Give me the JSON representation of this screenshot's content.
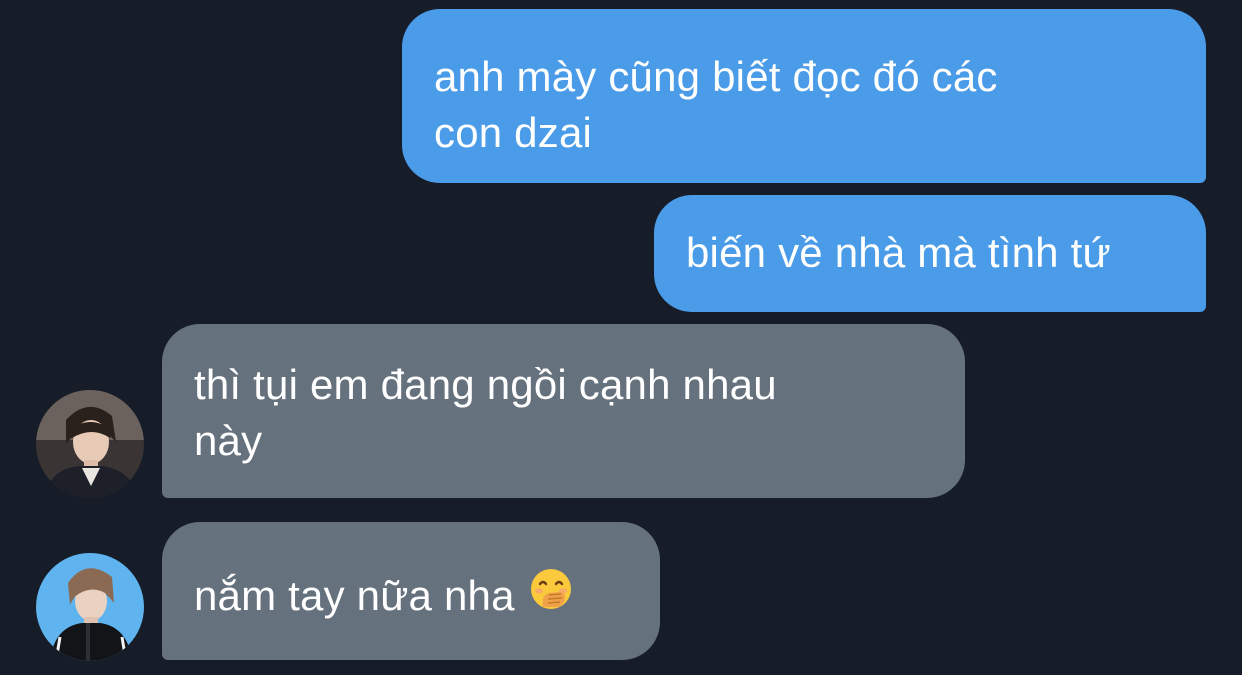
{
  "conversation": {
    "messages": [
      {
        "direction": "sent",
        "lines": [
          "anh mày cũng biết đọc đó các",
          "con dzai"
        ]
      },
      {
        "direction": "sent",
        "lines": [
          "biến về nhà mà tình tứ"
        ]
      },
      {
        "direction": "received",
        "lines": [
          "thì tụi em đang ngồi cạnh nhau",
          "này"
        ]
      },
      {
        "direction": "received",
        "lines": [
          "nắm tay nữa nha"
        ],
        "emoji": "hand-over-mouth-emoji"
      }
    ]
  },
  "colors": {
    "background": "#161d28",
    "sent_bubble": "#4a9be8",
    "received_bubble": "#66717e",
    "text": "#ffffff",
    "avatar2_ring": "#5fb3ee"
  }
}
